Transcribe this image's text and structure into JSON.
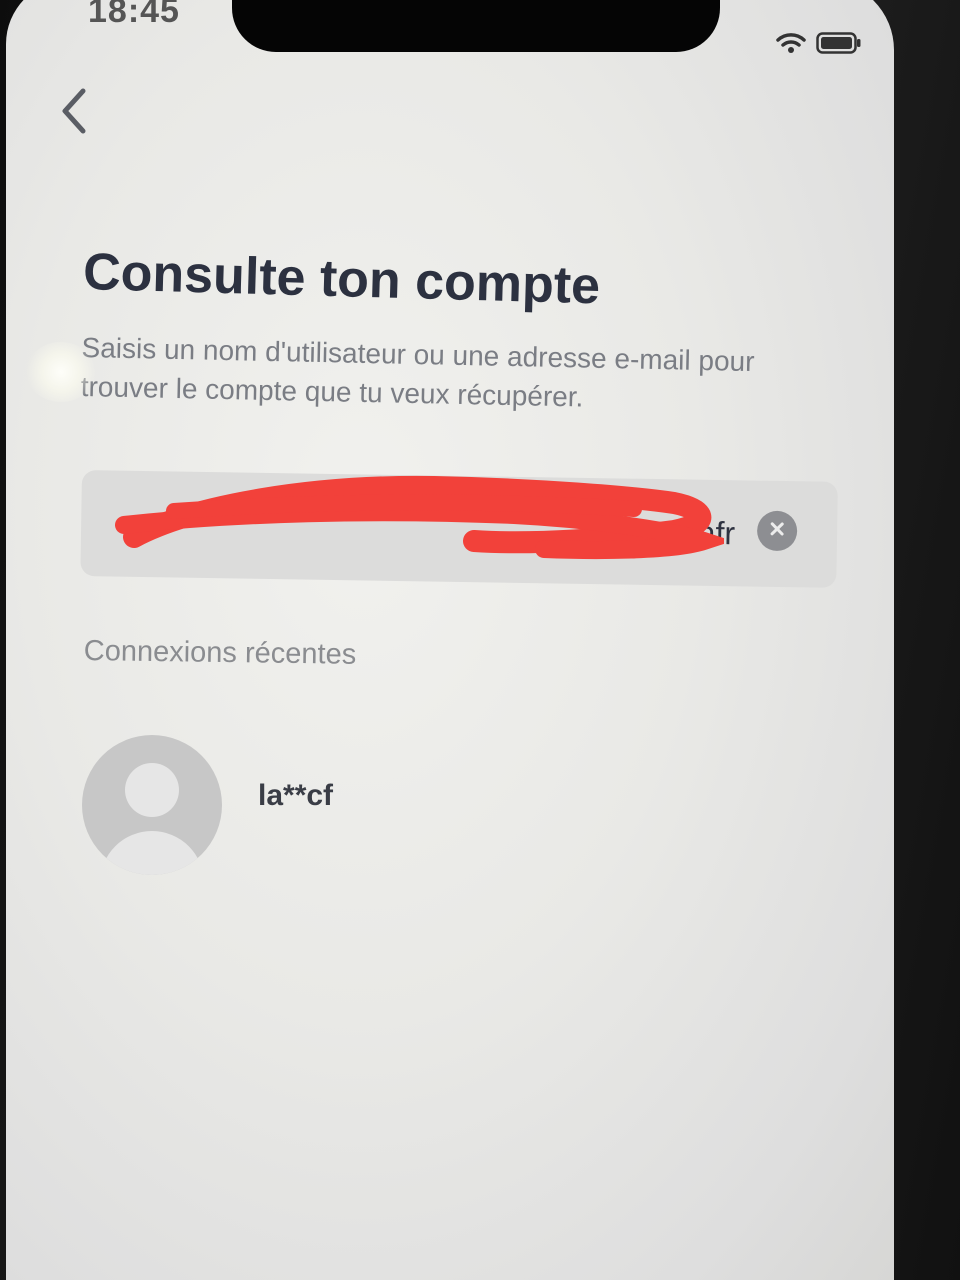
{
  "status_bar": {
    "time": "18:45",
    "wifi_icon": "wifi-icon",
    "battery_icon": "battery-icon"
  },
  "nav": {
    "back_icon": "chevron-left-icon"
  },
  "header": {
    "title": "Consulte ton compte",
    "subtitle": "Saisis un nom d'utilisateur ou une adresse e-mail pour trouver le compte que tu veux récupérer."
  },
  "search": {
    "value": "ersiafr",
    "clear_icon": "close-circle-icon",
    "redacted": true,
    "redaction_color": "#f2413a"
  },
  "recent": {
    "label": "Connexions récentes",
    "accounts": [
      {
        "username": "la**cf",
        "avatar_icon": "default-avatar-icon"
      }
    ]
  },
  "colors": {
    "background": "#ececea",
    "title": "#2c3140",
    "muted_text": "#7a7d84",
    "field_background": "#dcdcdb",
    "avatar": "#c7c7c7"
  }
}
